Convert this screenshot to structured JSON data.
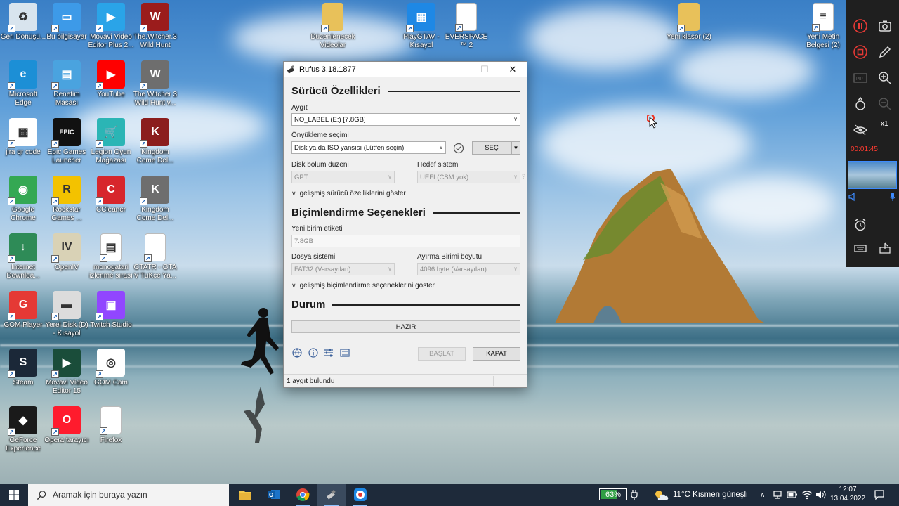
{
  "desktop_icons": [
    {
      "label": "Geri Dönüşü...",
      "icon": "recycle-bin-icon",
      "color": "#d8e4ee"
    },
    {
      "label": "Bu bilgisayar",
      "icon": "this-pc-icon",
      "color": "#3d9ae8"
    },
    {
      "label": "Movavi Video Editor Plus 2...",
      "icon": "movavi-icon",
      "color": "#2aa4e8"
    },
    {
      "label": "The.Witcher.3 Wild Hunt",
      "icon": "witcher-icon",
      "color": "#9b1c1c"
    },
    {
      "label": "Microsoft Edge",
      "icon": "edge-icon",
      "color": "#1c8fd6"
    },
    {
      "label": "Denetim Masası",
      "icon": "control-panel-icon",
      "color": "#4aa3df"
    },
    {
      "label": "YouTube",
      "icon": "youtube-icon",
      "color": "#ff0000"
    },
    {
      "label": "The Witcher 3 Wild Hunt v...",
      "icon": "witcher-icon",
      "color": "#6e6e6e"
    },
    {
      "label": "jira qr code",
      "icon": "qr-code-icon",
      "color": "#ffffff"
    },
    {
      "label": "Epic Games Launcher",
      "icon": "epic-games-icon",
      "color": "#111111"
    },
    {
      "label": "Legion Oyun Mağazası",
      "icon": "legion-store-icon",
      "color": "#2bb5b5"
    },
    {
      "label": "Kingdom Come Del...",
      "icon": "kingdom-come-icon",
      "color": "#8b1d1d"
    },
    {
      "label": "Google Chrome",
      "icon": "chrome-icon",
      "color": "#34a853"
    },
    {
      "label": "Rockstar Games ...",
      "icon": "rockstar-icon",
      "color": "#f3c200"
    },
    {
      "label": "CCleaner",
      "icon": "ccleaner-icon",
      "color": "#d7262c"
    },
    {
      "label": "Kingdom Come Del...",
      "icon": "kingdom-come-icon",
      "color": "#6e6e6e"
    },
    {
      "label": "Internet Downloa...",
      "icon": "internet-download-manager-icon",
      "color": "#2e8b57"
    },
    {
      "label": "OpenIV",
      "icon": "openiv-icon",
      "color": "#d9d2b6"
    },
    {
      "label": "monogatari izlenme sırası",
      "icon": "document-icon",
      "color": "#ffffff"
    },
    {
      "label": "GTATR - GTA V TuKce Ya...",
      "icon": "file-icon",
      "color": "#ffffff"
    },
    {
      "label": "GOM Player",
      "icon": "gom-player-icon",
      "color": "#e53935"
    },
    {
      "label": "Yerel Disk (D) - Kısayol",
      "icon": "drive-icon",
      "color": "#dcdcdc"
    },
    {
      "label": "Twitch Studio",
      "icon": "twitch-icon",
      "color": "#9146ff"
    },
    {
      "label": "Steam",
      "icon": "steam-icon",
      "color": "#1b2838"
    },
    {
      "label": "Movavi Video Editor 15",
      "icon": "movavi-icon",
      "color": "#1a4d3a"
    },
    {
      "label": "GOM Cam",
      "icon": "gom-cam-icon",
      "color": "#ffffff"
    },
    {
      "label": "GeForce Experience",
      "icon": "geforce-icon",
      "color": "#1a1a1a"
    },
    {
      "label": "Opera tarayıcı",
      "icon": "opera-icon",
      "color": "#ff1b2d"
    },
    {
      "label": "Firefox",
      "icon": "file-icon",
      "color": "#ffffff"
    },
    {
      "label": "Düzenlenecek Videolar",
      "icon": "folder-icon",
      "color": "#e8c15a"
    },
    {
      "label": "PlayGTAV - Kısayol",
      "icon": "playgtav-icon",
      "color": "#1e88e5"
    },
    {
      "label": "EVERSPACE™ 2",
      "icon": "file-icon",
      "color": "#ffffff"
    },
    {
      "label": "Yeni klasör (2)",
      "icon": "folder-icon",
      "color": "#e8c15a"
    },
    {
      "label": "Yeni Metin Belgesi (2)",
      "icon": "text-file-icon",
      "color": "#ffffff"
    }
  ],
  "rufus": {
    "title": "Rufus 3.18.1877",
    "drive_properties_heading": "Sürücü Özellikleri",
    "device_label": "Aygıt",
    "device_value": "NO_LABEL (E:) [7.8GB]",
    "boot_selection_label": "Önyükleme seçimi",
    "boot_selection_value": "Disk ya da ISO yansısı (Lütfen seçin)",
    "select_button": "SEÇ",
    "partition_scheme_label": "Disk bölüm düzeni",
    "partition_scheme_value": "GPT",
    "target_system_label": "Hedef sistem",
    "target_system_value": "UEFI (CSM yok)",
    "help_mark": "?",
    "advanced_drive_toggle": "gelişmiş sürücü özelliklerini göster",
    "format_options_heading": "Biçimlendirme Seçenekleri",
    "volume_label_label": "Yeni birim etiketi",
    "volume_label_value": "7.8GB",
    "file_system_label": "Dosya sistemi",
    "file_system_value": "FAT32 (Varsayılan)",
    "cluster_size_label": "Ayırma Birimi boyutu",
    "cluster_size_value": "4096 byte (Varsayılan)",
    "advanced_format_toggle": "gelişmiş biçimlendirme seçeneklerini göster",
    "status_heading": "Durum",
    "status_value": "HAZIR",
    "start_button": "BAŞLAT",
    "close_button": "KAPAT",
    "statusbar_text": "1 aygıt bulundu"
  },
  "recorder": {
    "time": "00:01:45",
    "zoom": "x1"
  },
  "taskbar": {
    "search_placeholder": "Aramak için buraya yazın",
    "battery_percent": 63,
    "battery_text": "63%",
    "weather": "11°C  Kısmen güneşli",
    "time": "12:07",
    "date": "13.04.2022"
  },
  "colors": {
    "taskbar_bg": "#1e2a3a",
    "battery_fill": "#2f9e44",
    "recording_red": "#ff3b30"
  }
}
